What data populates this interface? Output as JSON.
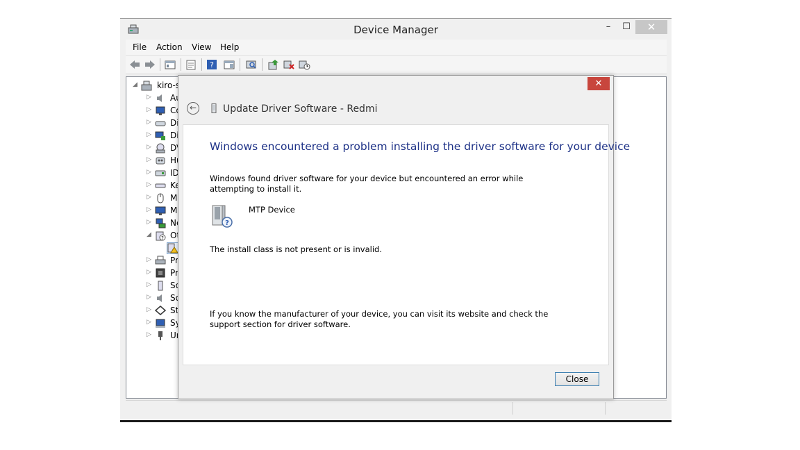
{
  "window": {
    "title": "Device Manager",
    "minimize_glyph": "–",
    "maximize_glyph": "☐",
    "close_glyph": "✕"
  },
  "menu": {
    "file": "File",
    "action": "Action",
    "view": "View",
    "help": "Help"
  },
  "toolbar": {
    "icons": [
      "back-arrow-icon",
      "forward-arrow-icon",
      "show-hide-console-tree-icon",
      "properties-icon",
      "help-icon",
      "action-pane-icon",
      "scan-hardware-icon",
      "update-driver-icon",
      "uninstall-icon",
      "enable-device-icon"
    ]
  },
  "tree": {
    "root": "kiro-s",
    "categories": [
      "Au",
      "Co",
      "Di",
      "Di",
      "DV",
      "Hu",
      "ID",
      "Ke",
      "Mi",
      "Mi",
      "Ne",
      "Ot",
      "",
      "Pr",
      "Pr",
      "So",
      "So",
      "St",
      "Sy",
      "Un"
    ]
  },
  "dialog": {
    "close_glyph": "✕",
    "back_glyph": "←",
    "title": "Update Driver Software - Redmi",
    "heading": "Windows encountered a problem installing the driver software for your device",
    "para1": "Windows found driver software for your device but encountered an error while attempting to install it.",
    "device_name": "MTP Device",
    "error": "The install class is not present or is invalid.",
    "para2": "If you know the manufacturer of your device, you can visit its website and check the support section for driver software.",
    "close_button": "Close"
  },
  "colors": {
    "heading_blue": "#1e3287",
    "dialog_close_red": "#c8463d"
  }
}
